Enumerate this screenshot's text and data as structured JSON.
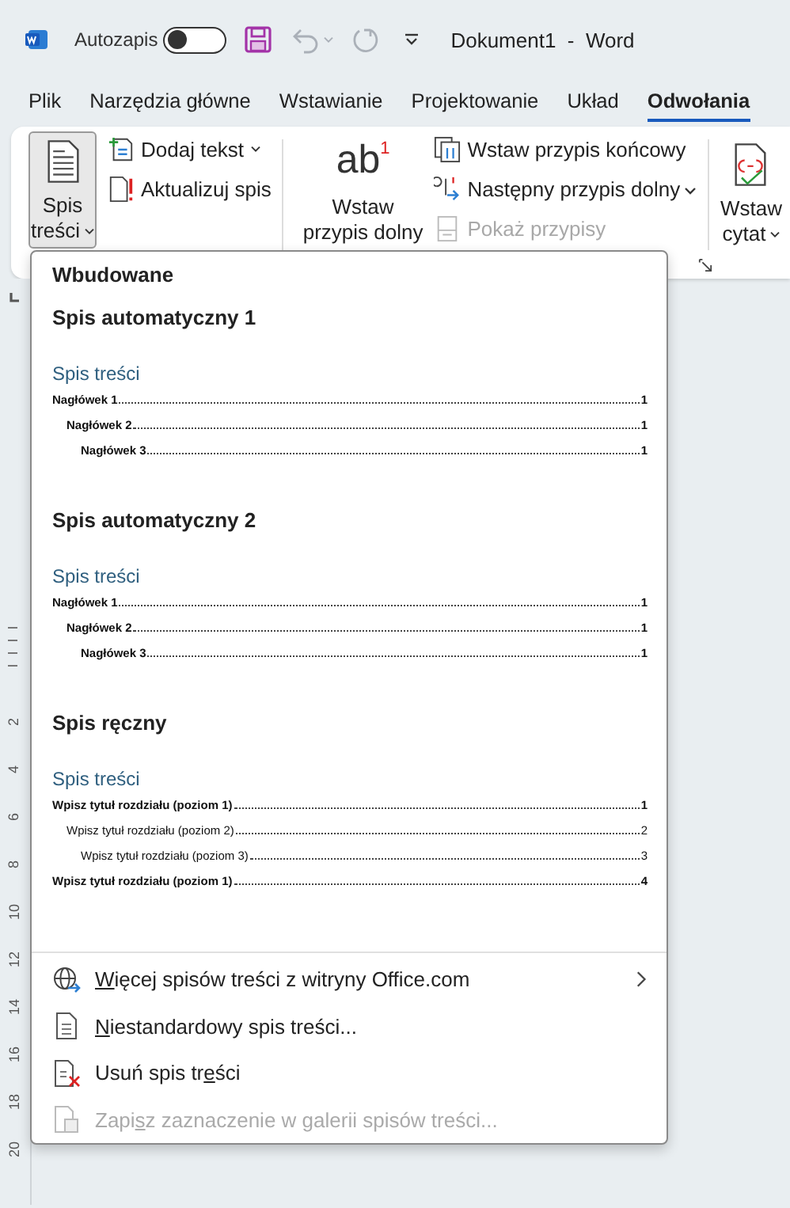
{
  "titlebar": {
    "autosave_label": "Autozapis",
    "autosave_on": false,
    "title": "Dokument1  -  Word"
  },
  "tabs": [
    {
      "label": "Plik",
      "selected": false
    },
    {
      "label": "Narzędzia główne",
      "selected": false
    },
    {
      "label": "Wstawianie",
      "selected": false
    },
    {
      "label": "Projektowanie",
      "selected": false
    },
    {
      "label": "Układ",
      "selected": false
    },
    {
      "label": "Odwołania",
      "selected": true
    }
  ],
  "ribbon": {
    "toc_button": {
      "lines": [
        "Spis",
        "treści"
      ],
      "pressed": true
    },
    "toc_small": [
      {
        "kind": "add-text",
        "label": "Dodaj tekst",
        "dropdown": true,
        "disabled": false
      },
      {
        "kind": "update",
        "label": "Aktualizuj spis",
        "dropdown": false,
        "disabled": false
      }
    ],
    "footnote_button": {
      "icon_text": "ab",
      "lines": [
        "Wstaw",
        "przypis dolny"
      ],
      "superscript": "1"
    },
    "footnote_small": [
      {
        "kind": "endnote",
        "label": "Wstaw przypis końcowy",
        "disabled": false
      },
      {
        "kind": "next",
        "label": "Następny przypis dolny",
        "disabled": false
      },
      {
        "kind": "show",
        "label": "Pokaż przypisy",
        "disabled": true
      }
    ],
    "citation_button": {
      "lines": [
        "Wstaw",
        "cytat"
      ]
    }
  },
  "menu": {
    "heading": "Wbudowane",
    "gallery": [
      {
        "title": "Spis automatyczny 1",
        "toc_title": "Spis treści",
        "entries": [
          {
            "text": "Nagłówek 1",
            "page": "1",
            "bold": true,
            "children": [
              {
                "text": "Nagłówek 2",
                "page": "1",
                "bold": true,
                "children": [
                  {
                    "text": "Nagłówek 3",
                    "page": "1",
                    "bold": true
                  }
                ]
              }
            ]
          }
        ]
      },
      {
        "title": "Spis automatyczny 2",
        "toc_title": "Spis treści",
        "entries": [
          {
            "text": "Nagłówek 1",
            "page": "1",
            "bold": true,
            "children": [
              {
                "text": "Nagłówek 2",
                "page": "1",
                "bold": true,
                "children": [
                  {
                    "text": "Nagłówek 3",
                    "page": "1",
                    "bold": true
                  }
                ]
              }
            ]
          }
        ]
      },
      {
        "title": "Spis ręczny",
        "toc_title": "Spis treści",
        "entries": [
          {
            "text": "Wpisz tytuł rozdziału (poziom 1)",
            "page": "1",
            "bold": true,
            "children": [
              {
                "text": "Wpisz tytuł rozdziału (poziom 2)",
                "page": "2",
                "bold": false,
                "children": [
                  {
                    "text": "Wpisz tytuł rozdziału (poziom 3)",
                    "page": "3",
                    "bold": false
                  }
                ]
              }
            ]
          },
          {
            "text": "Wpisz tytuł rozdziału (poziom 1)",
            "page": "4",
            "bold": true
          }
        ]
      }
    ],
    "commands": [
      {
        "kind": "globe",
        "label": {
          "access_key": "W",
          "after": "ięcej spisów treści z witryny Office.com"
        },
        "submenu": true,
        "disabled": false
      },
      {
        "kind": "custom",
        "label": {
          "access_key": "N",
          "after": "iestandardowy spis treści..."
        },
        "submenu": false,
        "disabled": false
      },
      {
        "kind": "remove",
        "label": {
          "before": "Usuń spis tr",
          "access_key": "e",
          "after": "ści"
        },
        "submenu": false,
        "disabled": false
      },
      {
        "kind": "save",
        "label": {
          "before": "Zapi",
          "access_key": "s",
          "after": "z zaznaczenie w galerii spisów treści..."
        },
        "submenu": false,
        "disabled": true
      }
    ]
  },
  "ruler_numbers": [
    "2",
    "4",
    "6",
    "8",
    "10",
    "12",
    "14",
    "16",
    "18",
    "20"
  ]
}
